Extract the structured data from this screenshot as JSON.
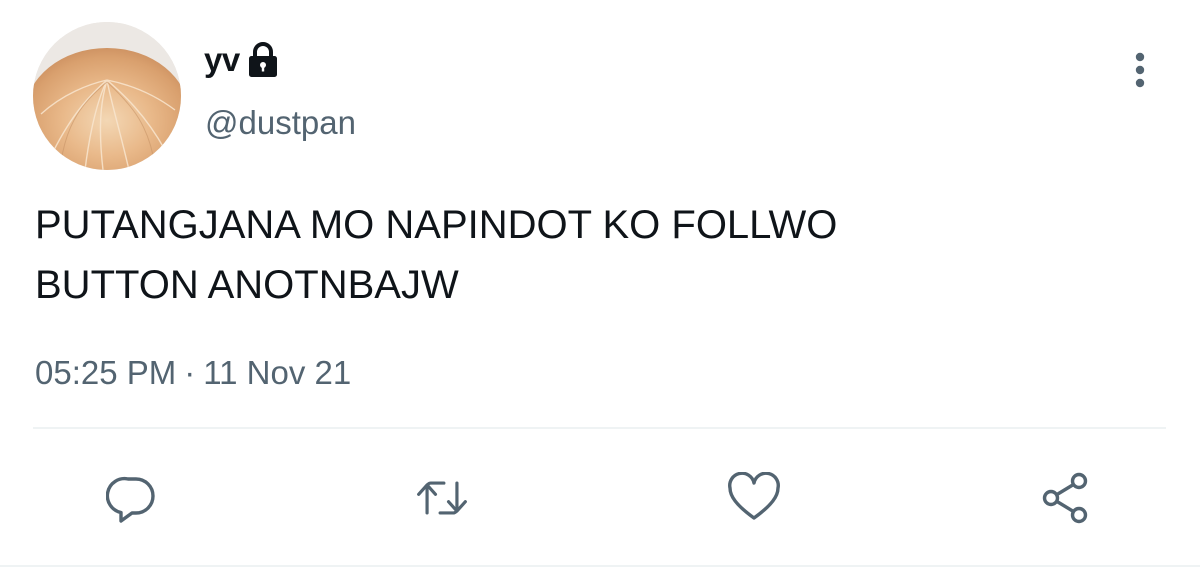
{
  "tweet": {
    "display_name": "yv",
    "protected": true,
    "handle": "@dustpan",
    "text": "PUTANGJANA MO NAPINDOT KO FOLLWO\nBUTTON ANOTNBAJW",
    "time": "05:25 PM",
    "separator": "·",
    "date": "11 Nov 21"
  },
  "icons": {
    "lock": "lock-icon",
    "more": "more-vertical-icon",
    "reply": "reply-icon",
    "retweet": "retweet-icon",
    "like": "heart-icon",
    "share": "share-icon"
  },
  "colors": {
    "text": "#0f1419",
    "secondary": "#536471",
    "divider": "#eff3f4"
  }
}
